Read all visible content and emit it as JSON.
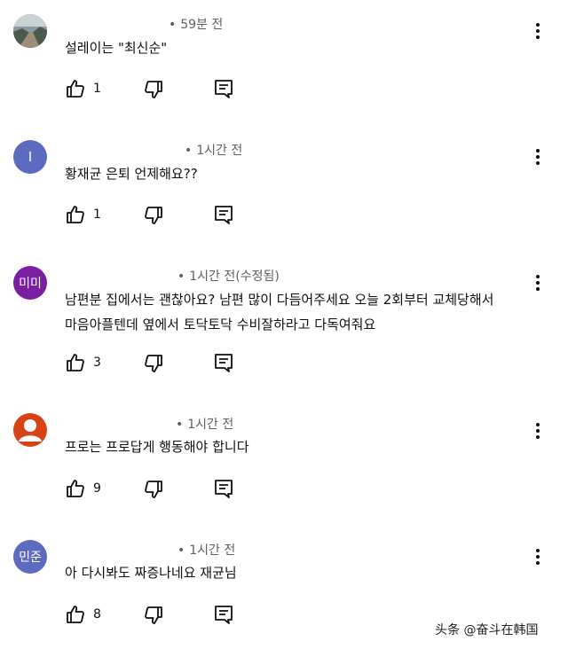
{
  "comments": [
    {
      "avatar_type": "image",
      "avatar_text": "",
      "avatar_color": "#6f6f6f",
      "time": "59분 전",
      "text": "설레이는 \"최신순\"",
      "likes": "1"
    },
    {
      "avatar_type": "letter",
      "avatar_text": "I",
      "avatar_color": "#5c6bc0",
      "time": "1시간 전",
      "text": "황재균 은퇴 언제해요??",
      "likes": "1"
    },
    {
      "avatar_type": "letter",
      "avatar_text": "미미",
      "avatar_color": "#7b1fa2",
      "time": "1시간 전(수정됨)",
      "text": "남편분 집에서는 괜찮아요? 남편 많이 다듬어주세요 오늘 2회부터 교체당해서 마음아플텐데 옆에서 토닥토닥 수비잘하라고 다독여줘요",
      "likes": "3"
    },
    {
      "avatar_type": "default",
      "avatar_text": "",
      "avatar_color": "#d84315",
      "time": "1시간 전",
      "text": "프로는 프로답게 행동해야 합니다",
      "likes": "9"
    },
    {
      "avatar_type": "letter",
      "avatar_text": "민준",
      "avatar_color": "#5c6bc0",
      "time": "1시간 전",
      "text": "아 다시봐도 짜증나네요 재균님",
      "likes": "8"
    }
  ],
  "meta_dot": "•",
  "watermark": "头条 @奋斗在韩国"
}
